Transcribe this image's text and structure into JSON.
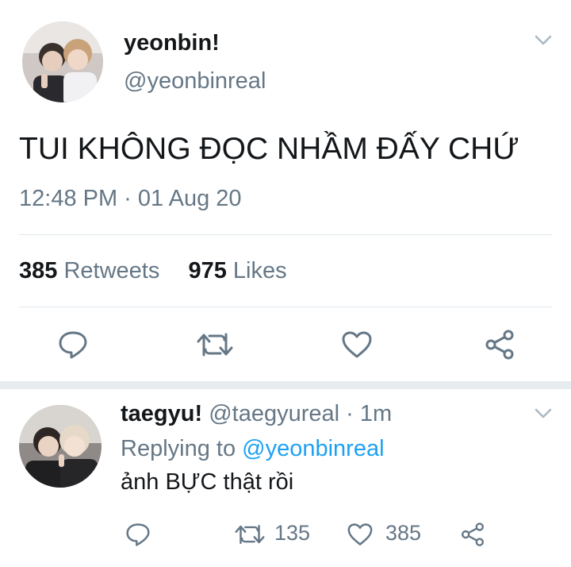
{
  "main_tweet": {
    "display_name": "yeonbin!",
    "handle": "@yeonbinreal",
    "text": "TUI KHÔNG ĐỌC NHẦM ĐẤY CHỨ",
    "timestamp": "12:48 PM · 01 Aug 20",
    "stats": {
      "retweets_count": "385",
      "retweets_label": "Retweets",
      "likes_count": "975",
      "likes_label": "Likes"
    }
  },
  "reply": {
    "display_name": "taegyu!",
    "handle": "@taegyureal",
    "time": "· 1m",
    "replying_label": "Replying to",
    "replying_handle": "@yeonbinreal",
    "text": "ảnh BỰC thật rồi",
    "retweet_count": "135",
    "like_count": "385"
  },
  "icons": [
    "chevron-down-icon",
    "reply-icon",
    "retweet-icon",
    "like-icon",
    "share-icon"
  ],
  "colors": {
    "text": "#14171a",
    "muted": "#657786",
    "link": "#1da1f2",
    "divider": "#e1e8ed",
    "separator": "#e6ecf0"
  }
}
